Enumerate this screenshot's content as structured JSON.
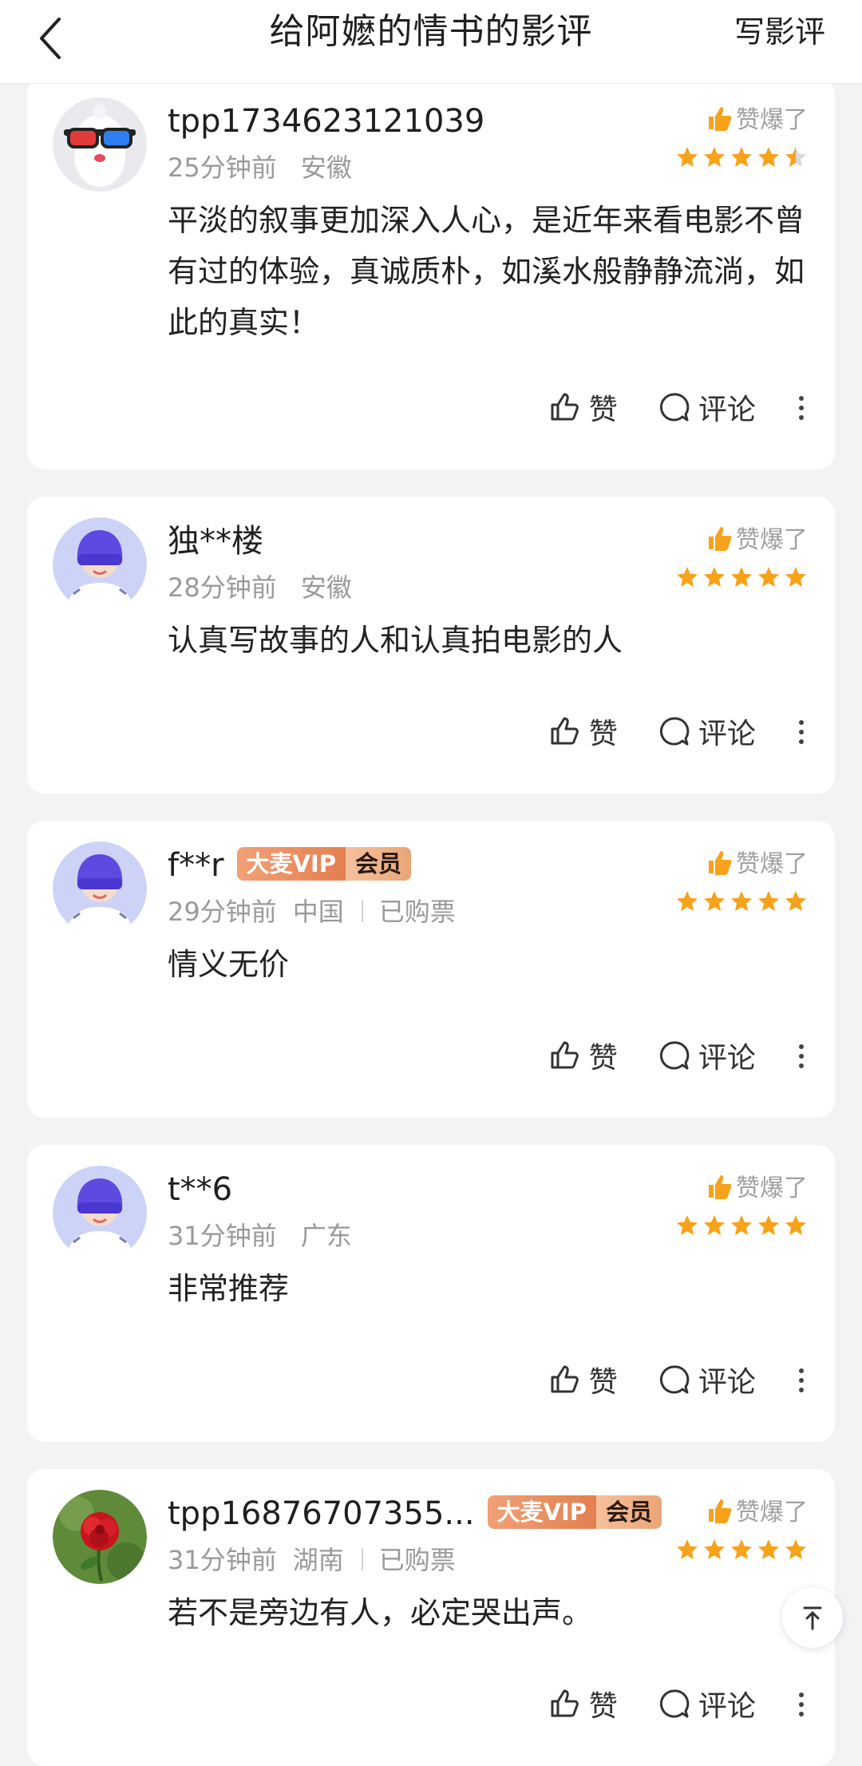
{
  "header": {
    "title": "给阿嬷的情书的影评",
    "write_label": "写影评"
  },
  "colors": {
    "star_full": "#f7a21b",
    "star_empty": "#d9d9d9",
    "vip_orange": "#e47f50"
  },
  "reviews": [
    {
      "user": "tpp1734623121039",
      "avatar": "3d-glasses-avatar-icon",
      "time": "25分钟前",
      "region": "安徽",
      "praise": "赞爆了",
      "rating": 4.5,
      "content": "平淡的叙事更加深入人心，是近年来看电影不曾有过的体验，真诚质朴，如溪水般静静流淌，如此的真实！",
      "like_label": "赞",
      "comment_label": "评论"
    },
    {
      "user": "独**楼",
      "avatar": "default-user-avatar-icon",
      "time": "28分钟前",
      "region": "安徽",
      "praise": "赞爆了",
      "rating": 5,
      "content": "认真写故事的人和认真拍电影的人",
      "like_label": "赞",
      "comment_label": "评论"
    },
    {
      "user": "f**r",
      "avatar": "default-user-avatar-icon",
      "vip_left": "大麦VIP",
      "vip_right": "会员",
      "time": "29分钟前",
      "region": "中国",
      "ticket": "已购票",
      "praise": "赞爆了",
      "rating": 5,
      "content": "情义无价",
      "like_label": "赞",
      "comment_label": "评论"
    },
    {
      "user": "t**6",
      "avatar": "default-user-avatar-icon",
      "time": "31分钟前",
      "region": "广东",
      "praise": "赞爆了",
      "rating": 5,
      "content": "非常推荐",
      "like_label": "赞",
      "comment_label": "评论"
    },
    {
      "user": "tpp16876707355...",
      "avatar": "red-rose-avatar-icon",
      "vip_left": "大麦VIP",
      "vip_right": "会员",
      "time": "31分钟前",
      "region": "湖南",
      "ticket": "已购票",
      "praise": "赞爆了",
      "rating": 5,
      "content": "若不是旁边有人，必定哭出声。",
      "like_label": "赞",
      "comment_label": "评论"
    }
  ]
}
